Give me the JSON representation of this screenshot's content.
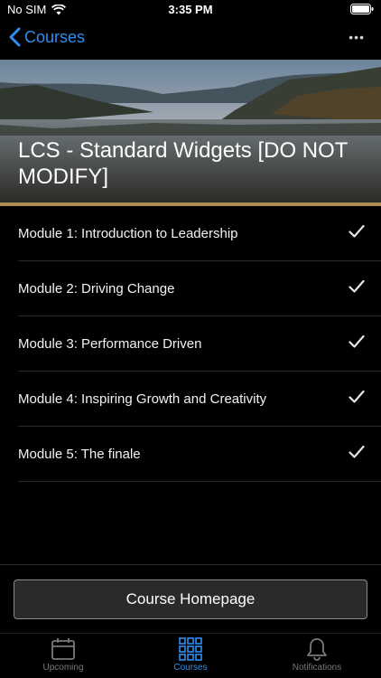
{
  "status": {
    "carrier": "No SIM",
    "time": "3:35 PM"
  },
  "nav": {
    "back_label": "Courses",
    "more_label": "•••"
  },
  "course": {
    "title": "LCS - Standard Widgets [DO NOT MODIFY]"
  },
  "modules": [
    {
      "label": "Module 1: Introduction to Leadership",
      "completed": true
    },
    {
      "label": "Module 2: Driving Change",
      "completed": true
    },
    {
      "label": "Module 3: Performance Driven",
      "completed": true
    },
    {
      "label": "Module 4: Inspiring Growth and Creativity",
      "completed": true
    },
    {
      "label": "Module 5: The finale",
      "completed": true
    }
  ],
  "action": {
    "homepage_label": "Course Homepage"
  },
  "tabs": [
    {
      "label": "Upcoming",
      "icon": "calendar-icon",
      "active": false
    },
    {
      "label": "Courses",
      "icon": "grid-icon",
      "active": true
    },
    {
      "label": "Notifications",
      "icon": "bell-icon",
      "active": false
    }
  ],
  "colors": {
    "accent": "#2f8ef0",
    "hero_underline": "#b08d57",
    "background": "#000000"
  }
}
